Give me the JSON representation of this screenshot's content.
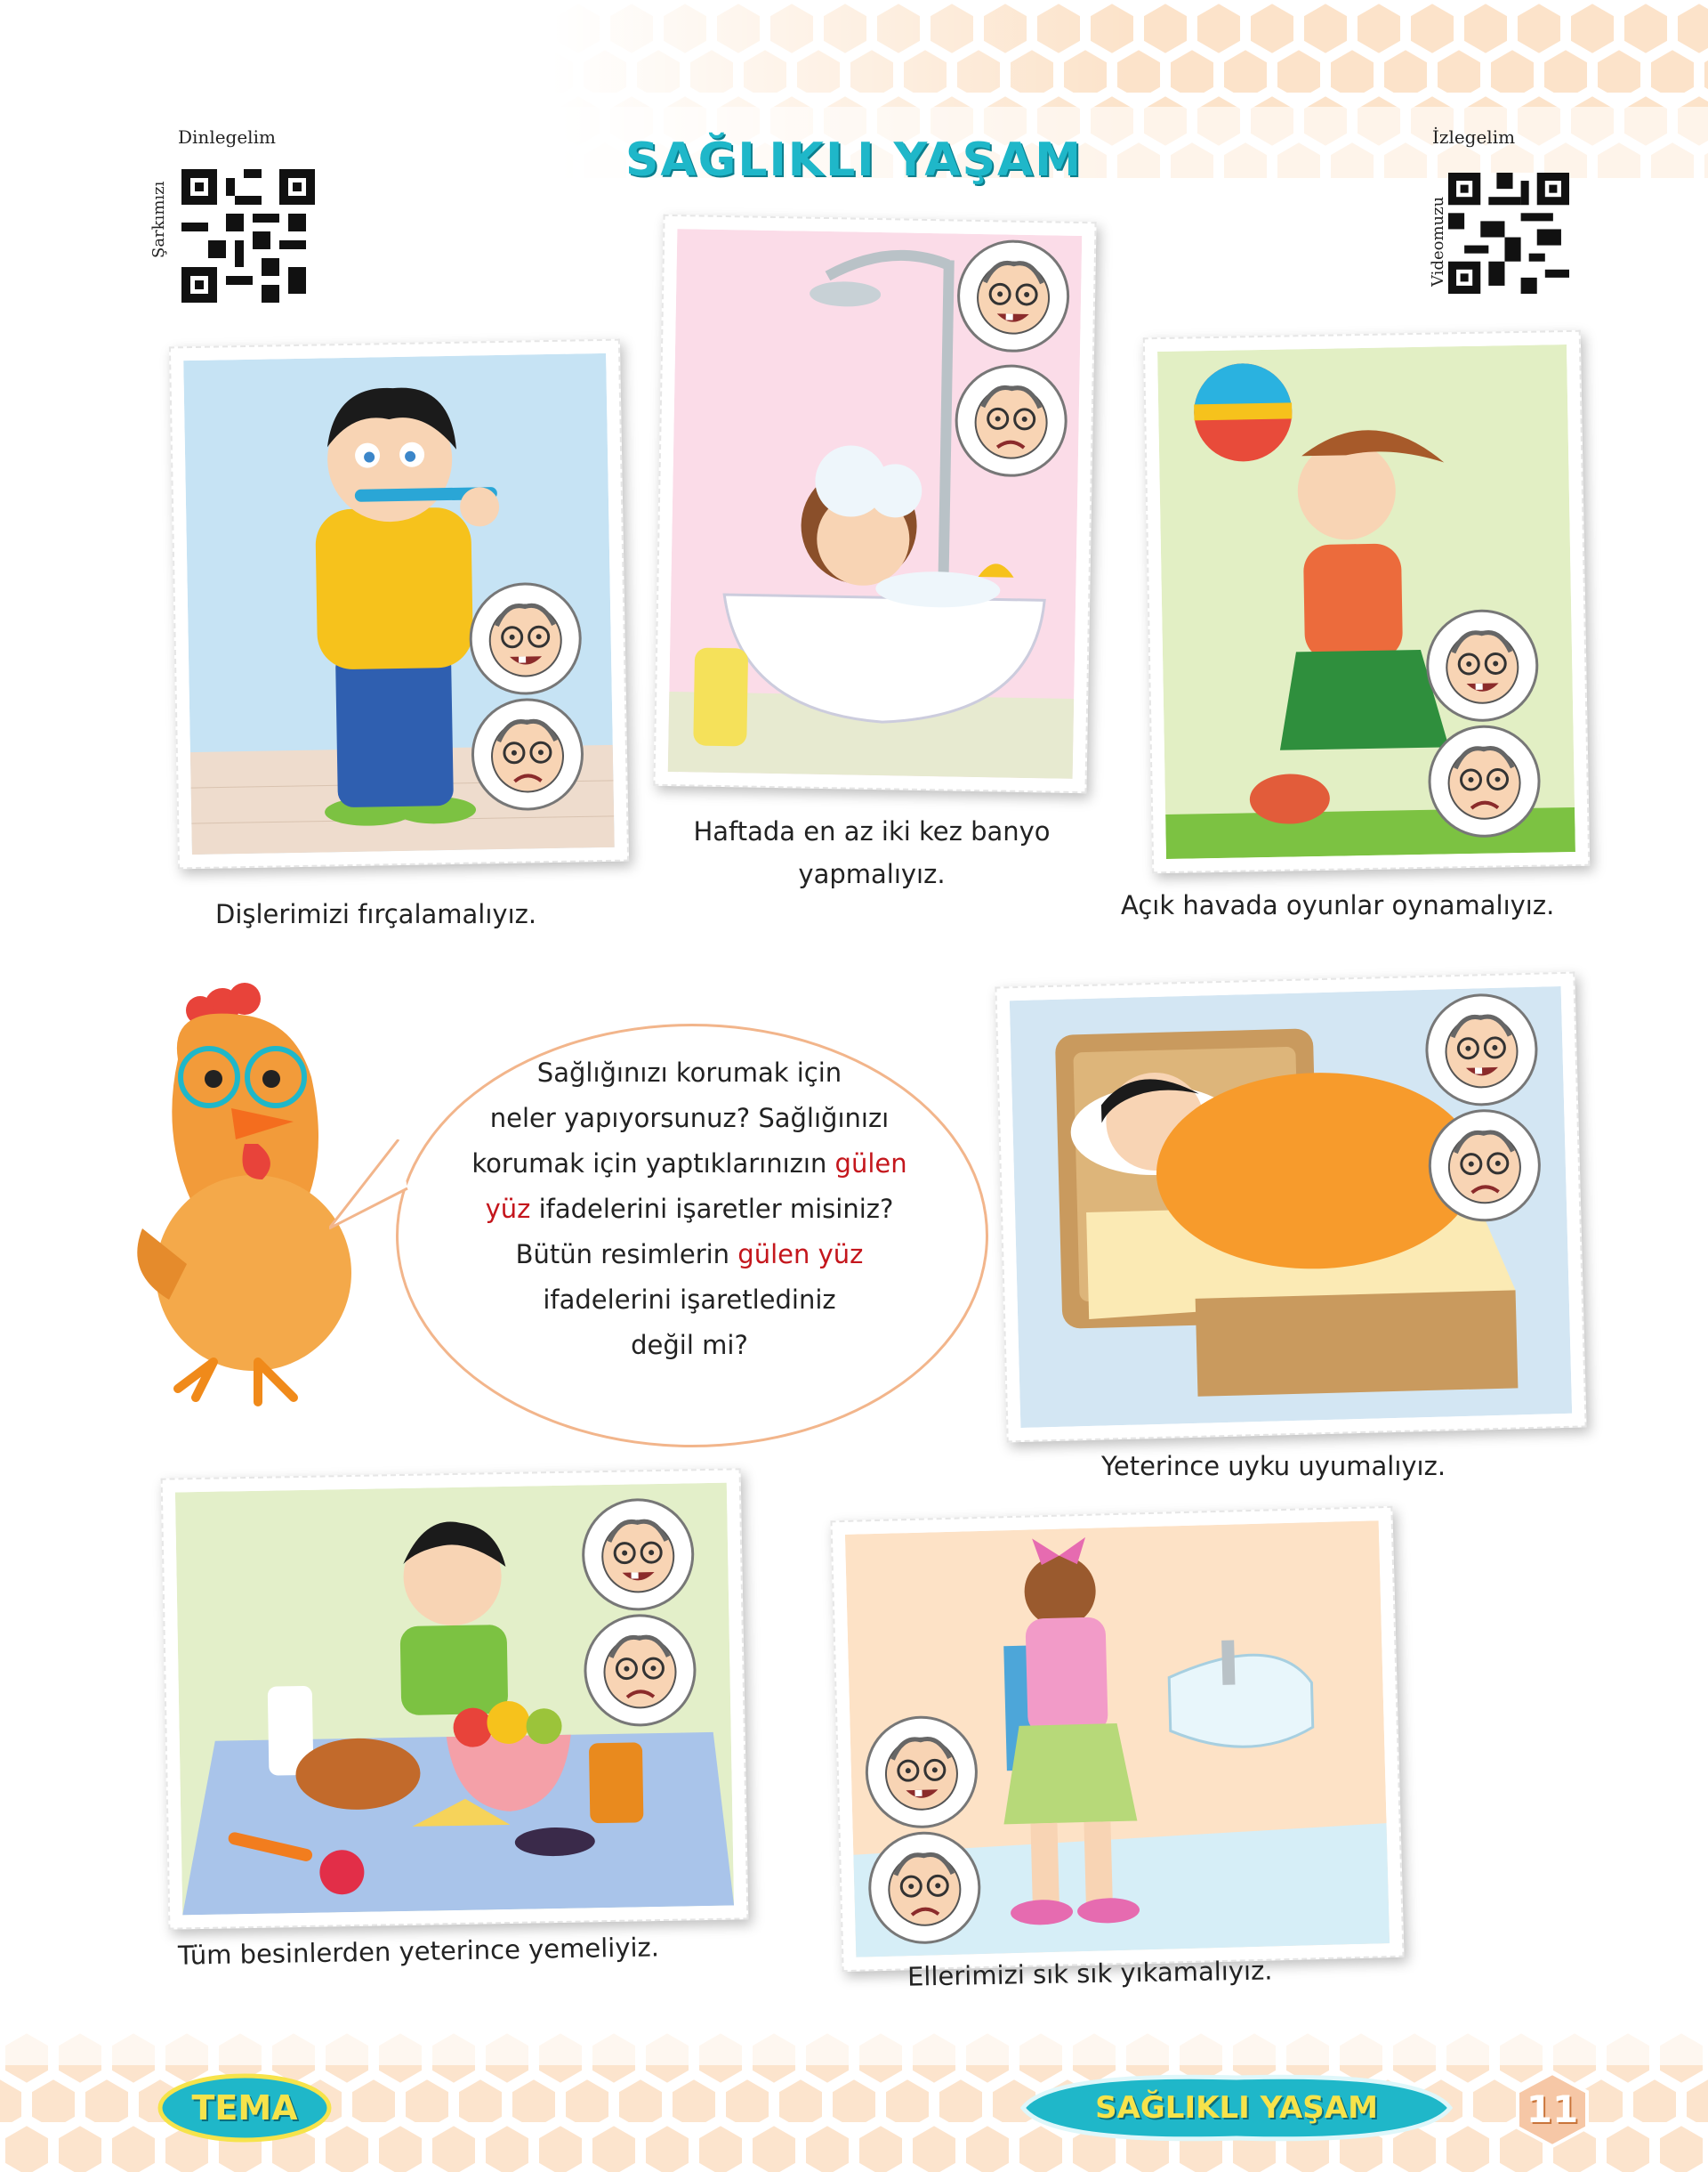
{
  "title": "SAĞLIKLI YAŞAM",
  "qr_left": {
    "caption": "Dinlegelim",
    "side": "Şarkımızı"
  },
  "qr_right": {
    "caption": "İzlegelim",
    "side": "Videomuzu"
  },
  "cards": [
    {
      "caption": "Dişlerimizi fırçalamalıyız."
    },
    {
      "caption_line1": "Haftada en az iki kez banyo",
      "caption_line2": "yapmalıyız."
    },
    {
      "caption": "Açık havada oyunlar oynamalıyız."
    },
    {
      "caption": "Yeterince uyku uyumalıyız."
    },
    {
      "caption": "Tüm besinlerden yeterince yemeliyiz."
    },
    {
      "caption": "Ellerimizi sık sık yıkamalıyız."
    }
  ],
  "bubble": {
    "l1": "Sağlığınızı korumak için",
    "l2": "neler yapıyorsunuz? Sağlığınızı",
    "l3a": "korumak için yaptıklarınızın ",
    "l3b": "gülen",
    "l4a": "yüz",
    "l4b": "  ifadelerini işaretler misiniz?",
    "l5a": "Bütün resimlerin ",
    "l5b": "gülen yüz",
    "l6": "ifadelerini işaretlediniz",
    "l7": "değil mi?"
  },
  "footer": {
    "tema": "TEMA",
    "theme_name": "SAĞLIKLI YAŞAM",
    "page_number": "11"
  },
  "colors": {
    "title": "#1fb7c9",
    "accent_red": "#c4161c",
    "hex": "#fbd9b8",
    "bubble_border": "#f2b58b"
  }
}
